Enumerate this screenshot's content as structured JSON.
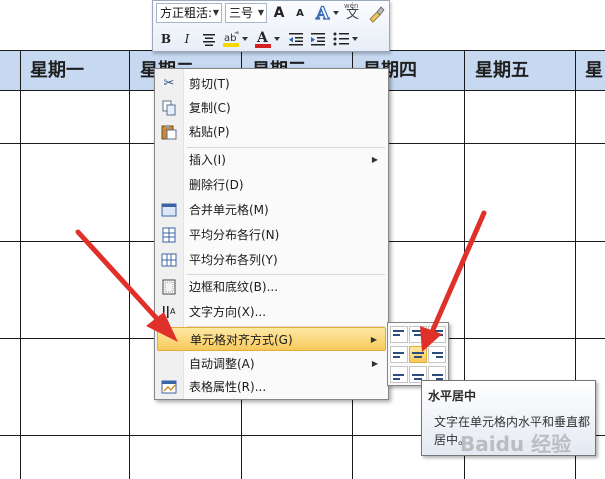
{
  "table": {
    "headers": [
      "星期一",
      "星期二",
      "星期三",
      "星期四",
      "星期五",
      "星"
    ]
  },
  "mini_toolbar": {
    "font_name": "方正粗活:",
    "font_size": "三号",
    "buttons": [
      "grow-font",
      "shrink-font",
      "text-effects",
      "phonetic-guide",
      "format-painter",
      "bold",
      "italic",
      "center",
      "highlight",
      "font-color",
      "decrease-indent",
      "increase-indent",
      "bullets"
    ],
    "bold_label": "B",
    "italic_label": "I",
    "grow_label": "A",
    "shrink_label": "A",
    "font_color_label": "A",
    "phonetic_label": "wén",
    "phonetic_char": "文",
    "accent_red": "#d42020",
    "accent_yellow": "#f5d800"
  },
  "context_menu": {
    "items": [
      {
        "label": "剪切(T)",
        "icon": "scissors-icon"
      },
      {
        "label": "复制(C)",
        "icon": "copy-icon"
      },
      {
        "label": "粘贴(P)",
        "icon": "paste-icon"
      },
      {
        "label": "插入(I)",
        "icon": "",
        "submenu": true
      },
      {
        "label": "删除行(D)",
        "icon": ""
      },
      {
        "label": "合并单元格(M)",
        "icon": "merge-cells-icon"
      },
      {
        "label": "平均分布各行(N)",
        "icon": "distribute-rows-icon"
      },
      {
        "label": "平均分布各列(Y)",
        "icon": "distribute-columns-icon"
      },
      {
        "label": "边框和底纹(B)...",
        "icon": "borders-icon"
      },
      {
        "label": "文字方向(X)...",
        "icon": "text-direction-icon"
      },
      {
        "label": "单元格对齐方式(G)",
        "icon": "",
        "submenu": true,
        "active": true
      },
      {
        "label": "自动调整(A)",
        "icon": "",
        "submenu": true
      },
      {
        "label": "表格属性(R)...",
        "icon": "table-properties-icon"
      }
    ]
  },
  "alignment_submenu": {
    "options": [
      "top-left",
      "top-center",
      "top-right",
      "middle-left",
      "middle-center",
      "middle-right",
      "bottom-left",
      "bottom-center",
      "bottom-right"
    ],
    "selected": "middle-center"
  },
  "tooltip": {
    "title": "水平居中",
    "body": "文字在单元格内水平和垂直都居中。"
  },
  "watermark": "Baidu 经验",
  "colors": {
    "header_fill": "#c6d9f1",
    "menu_highlight": "#f8c95c",
    "arrow_red": "#e0302a"
  }
}
